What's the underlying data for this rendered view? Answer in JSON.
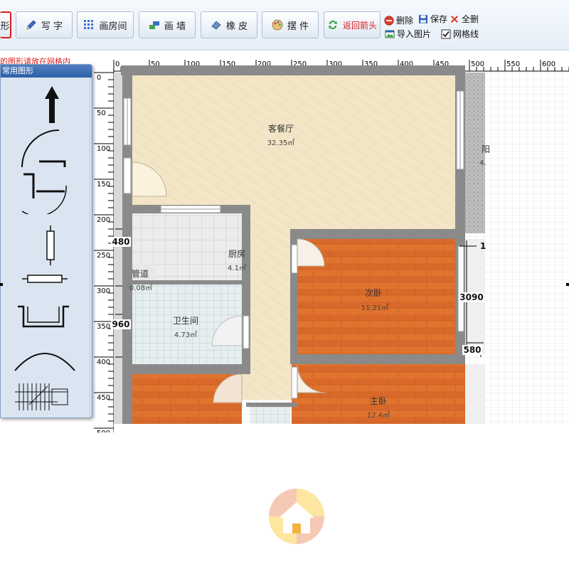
{
  "toolbar": {
    "partial_label": "形",
    "buttons": [
      {
        "label": "写 字",
        "icon": "pencil-icon"
      },
      {
        "label": "画房间",
        "icon": "grid-dots-icon"
      },
      {
        "label": "画 墙",
        "icon": "wall-icon"
      },
      {
        "label": "橡 皮",
        "icon": "eraser-icon"
      },
      {
        "label": "摆 件",
        "icon": "palette-icon"
      },
      {
        "label": "返回箭头",
        "icon": "refresh-arrows-icon"
      }
    ],
    "delete_label": "删除",
    "save_label": "保存",
    "clear_all_label": "全删",
    "import_image_label": "导入图片",
    "gridline_label": "网格线",
    "gridline_checked": true
  },
  "hint_text": "的图形请放在网格内",
  "palette": {
    "title": "常用图形",
    "shapes": [
      "arrow-up-icon",
      "door-arc-icon",
      "double-door-icon",
      "window-vertical-icon",
      "window-horizontal-icon",
      "bay-window-icon",
      "arch-icon",
      "stairs-icon"
    ]
  },
  "ruler": {
    "top_ticks": [
      "0",
      "50",
      "100",
      "150",
      "200",
      "250",
      "300",
      "350",
      "400",
      "450",
      "500",
      "550",
      "600"
    ],
    "left_ticks": [
      "0",
      "50",
      "100",
      "150",
      "200",
      "250",
      "300",
      "350",
      "400",
      "450",
      "500"
    ]
  },
  "floorplan": {
    "rooms": [
      {
        "name": "客餐厅",
        "area": "32.35㎡"
      },
      {
        "name": "厨房",
        "area": "4.1㎡"
      },
      {
        "name": "管道",
        "area": "0.08㎡"
      },
      {
        "name": "卫生间",
        "area": "4.73㎡"
      },
      {
        "name": "次卧",
        "area": "11.21㎡"
      },
      {
        "name": "主卧",
        "area": "12.4㎡"
      },
      {
        "name": "阳",
        "area": "4."
      }
    ],
    "dimensions": [
      "480",
      "960",
      "3090",
      "580",
      "1"
    ]
  },
  "colors": {
    "accent_red": "#d81e1e",
    "floor_orange": "#e0742f",
    "living_beige": "#f3e6c7",
    "wall_gray": "#8a8a8a"
  }
}
